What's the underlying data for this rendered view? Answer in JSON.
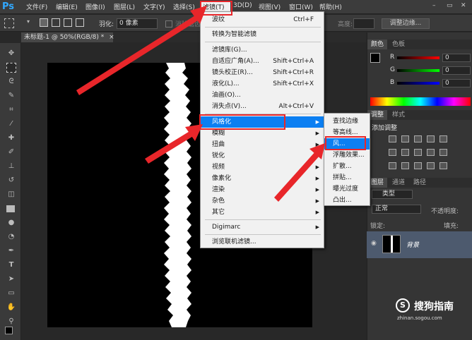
{
  "app": {
    "logo": "Ps"
  },
  "menubar": {
    "items": [
      "文件(F)",
      "编辑(E)",
      "图像(I)",
      "图层(L)",
      "文字(Y)",
      "选择(S)",
      "滤镜(T)",
      "3D(D)",
      "视图(V)",
      "窗口(W)",
      "帮助(H)"
    ]
  },
  "options": {
    "feather_label": "羽化:",
    "feather_value": "0 像素",
    "antialias": "消除锯齿",
    "height_label": "高度:",
    "refine_edge": "调整边缘..."
  },
  "document": {
    "tab_title": "未标题-1 @ 50%(RGB/8) *",
    "close": "×"
  },
  "filter_menu": {
    "items": [
      {
        "label": "波纹",
        "shortcut": "Ctrl+F"
      },
      {
        "label": "转换为智能滤镜",
        "shortcut": ""
      },
      {
        "label": "滤镜库(G)...",
        "shortcut": ""
      },
      {
        "label": "自适应广角(A)...",
        "shortcut": "Shift+Ctrl+A"
      },
      {
        "label": "镜头校正(R)...",
        "shortcut": "Shift+Ctrl+R"
      },
      {
        "label": "液化(L)...",
        "shortcut": "Shift+Ctrl+X"
      },
      {
        "label": "油画(O)...",
        "shortcut": ""
      },
      {
        "label": "消失点(V)...",
        "shortcut": "Alt+Ctrl+V"
      },
      {
        "label": "风格化",
        "shortcut": ""
      },
      {
        "label": "模糊",
        "shortcut": ""
      },
      {
        "label": "扭曲",
        "shortcut": ""
      },
      {
        "label": "锐化",
        "shortcut": ""
      },
      {
        "label": "视频",
        "shortcut": ""
      },
      {
        "label": "像素化",
        "shortcut": ""
      },
      {
        "label": "渲染",
        "shortcut": ""
      },
      {
        "label": "杂色",
        "shortcut": ""
      },
      {
        "label": "其它",
        "shortcut": ""
      },
      {
        "label": "Digimarc",
        "shortcut": ""
      },
      {
        "label": "浏览联机滤镜...",
        "shortcut": ""
      }
    ]
  },
  "stylize_submenu": {
    "items": [
      "查找边缘",
      "等高线...",
      "风...",
      "浮雕效果...",
      "扩散...",
      "拼贴...",
      "曝光过度",
      "凸出..."
    ]
  },
  "color_panel": {
    "tabs": [
      "颜色",
      "色板"
    ],
    "channels": [
      {
        "label": "R",
        "value": "0"
      },
      {
        "label": "G",
        "value": "0"
      },
      {
        "label": "B",
        "value": "0"
      }
    ]
  },
  "adjust_panel": {
    "tabs": [
      "调整",
      "样式"
    ],
    "title": "添加调整"
  },
  "layers_panel": {
    "tabs": [
      "图层",
      "通道",
      "路径"
    ],
    "kind": "类型",
    "blend": "正常",
    "opacity_label": "不透明度:",
    "lock_label": "锁定:",
    "fill_label": "填充:",
    "layer_name": "背景"
  },
  "watermark": {
    "main": "搜狗指南",
    "url": "zhinan.sogou.com"
  },
  "colors": {
    "accent": "#0c7ff2",
    "annotation": "#e8262a"
  }
}
